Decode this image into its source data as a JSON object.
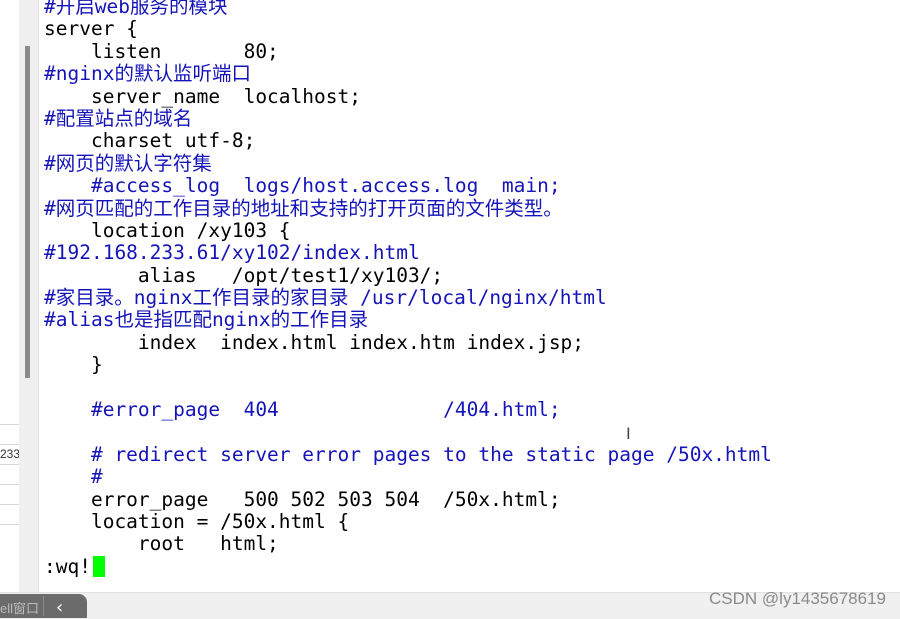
{
  "sidebar": {
    "list_items": [
      "",
      "233...",
      "",
      "",
      "",
      ""
    ]
  },
  "editor": {
    "lines": [
      {
        "text": "#开启web服务的模块",
        "comment": true
      },
      {
        "text": "server {",
        "comment": false
      },
      {
        "text": "    listen       80;",
        "comment": false
      },
      {
        "text": "#nginx的默认监听端口",
        "comment": true
      },
      {
        "text": "    server_name  localhost;",
        "comment": false
      },
      {
        "text": "#配置站点的域名",
        "comment": true
      },
      {
        "text": "    charset utf-8;",
        "comment": false
      },
      {
        "text": "#网页的默认字符集",
        "comment": true
      },
      {
        "text": "    #access_log  logs/host.access.log  main;",
        "comment": true
      },
      {
        "text": "#网页匹配的工作目录的地址和支持的打开页面的文件类型。",
        "comment": true
      },
      {
        "text": "    location /xy103 {",
        "comment": false
      },
      {
        "text": "#192.168.233.61/xy102/index.html",
        "comment": true
      },
      {
        "text": "        alias   /opt/test1/xy103/;",
        "comment": false
      },
      {
        "text": "#家目录。nginx工作目录的家目录 /usr/local/nginx/html",
        "comment": true
      },
      {
        "text": "#alias也是指匹配nginx的工作目录",
        "comment": true
      },
      {
        "text": "        index  index.html index.htm index.jsp;",
        "comment": false
      },
      {
        "text": "    }",
        "comment": false
      },
      {
        "text": "",
        "comment": false
      },
      {
        "text": "    #error_page  404              /404.html;",
        "comment": true
      },
      {
        "text": "",
        "comment": false
      },
      {
        "text": "    # redirect server error pages to the static page /50x.html",
        "comment": true
      },
      {
        "text": "    #",
        "comment": true
      },
      {
        "text": "    error_page   500 502 503 504  /50x.html;",
        "comment": false
      },
      {
        "text": "    location = /50x.html {",
        "comment": false
      },
      {
        "text": "        root   html;",
        "comment": false
      }
    ],
    "command": ":wq!",
    "cursor_color": "#00ff00",
    "comment_color": "#1414b8"
  },
  "bottom": {
    "tab_label": "ell窗口",
    "back_icon": "chevron-left"
  },
  "watermark": "CSDN @ly1435678619"
}
